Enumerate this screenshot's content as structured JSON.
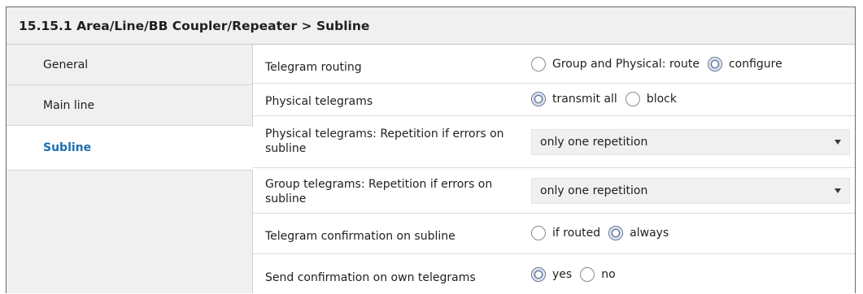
{
  "window": {
    "title": "15.15.1 Area/Line/BB Coupler/Repeater > Subline"
  },
  "sidebar": {
    "items": [
      {
        "label": "General"
      },
      {
        "label": "Main line"
      },
      {
        "label": "Subline",
        "active": true
      }
    ]
  },
  "params": {
    "telegram_routing": {
      "label": "Telegram routing",
      "options": [
        "Group and Physical: route",
        "configure"
      ],
      "selected": "configure"
    },
    "physical_telegrams": {
      "label": "Physical telegrams",
      "options": [
        "transmit all",
        "block"
      ],
      "selected": "transmit all"
    },
    "physical_repetition": {
      "label_line1": "Physical telegrams: Repetition if errors on",
      "label_line2": "subline",
      "value": "only one repetition"
    },
    "group_repetition": {
      "label_line1": "Group telegrams: Repetition if errors on",
      "label_line2": "subline",
      "value": "only one repetition"
    },
    "telegram_confirmation": {
      "label": "Telegram confirmation on subline",
      "options": [
        "if routed",
        "always"
      ],
      "selected": "always"
    },
    "send_confirmation": {
      "label": "Send confirmation on own telegrams",
      "options": [
        "yes",
        "no"
      ],
      "selected": "yes"
    }
  },
  "colors": {
    "active_tab_text": "#1d6fb0",
    "sidebar_bg": "#f0f0f0",
    "select_bg": "#f0f0f0"
  }
}
